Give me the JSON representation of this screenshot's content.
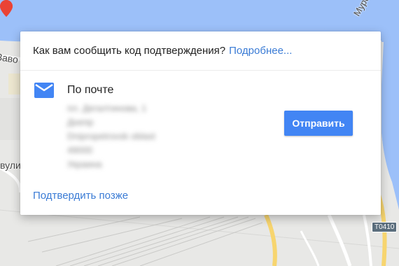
{
  "map": {
    "labels": {
      "zavod": "Заво",
      "vuli": "вули",
      "murska": "Мурськ",
      "road_badge": "Т0410"
    },
    "colors": {
      "water": "#9cc0f9",
      "land": "#e8e8e6",
      "road": "#f7d56f",
      "pin": "#ea4335"
    }
  },
  "dialog": {
    "question": "Как вам сообщить код подтверждения?",
    "more_link": "Подробнее...",
    "option": {
      "icon": "mail-icon",
      "title": "По почте",
      "address_lines": [
        "пл. Дегалтинова, 1",
        "Днепр",
        "Dnipropetrovsk oblast",
        "49000",
        "Украина"
      ]
    },
    "send_button": "Отправить",
    "later_link": "Подтвердить позже",
    "colors": {
      "accent": "#4285f4",
      "link": "#3a7bd5"
    }
  }
}
